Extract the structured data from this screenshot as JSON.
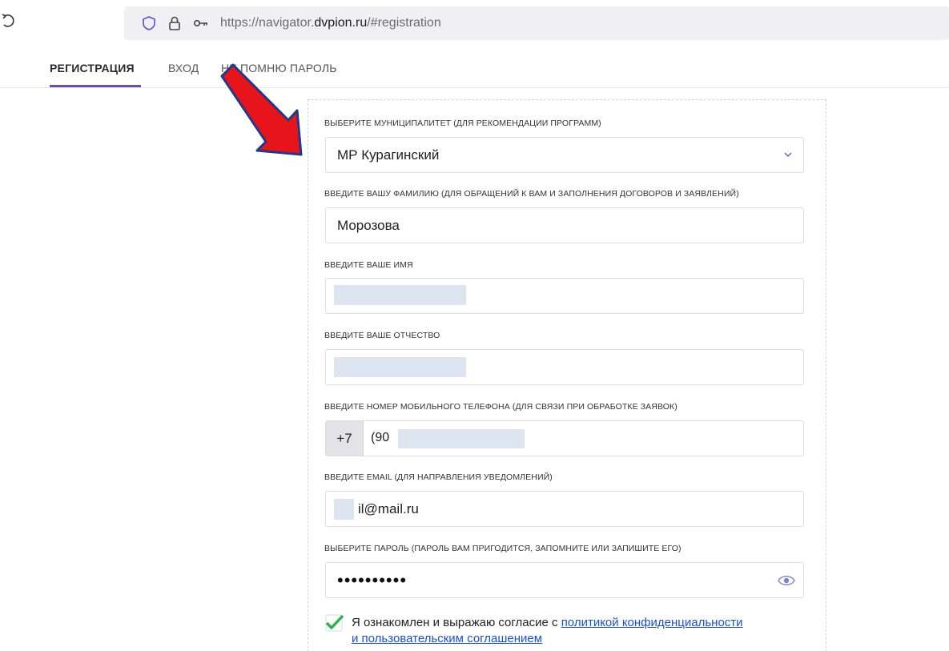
{
  "browser": {
    "url_prefix": "https://navigator.",
    "url_host": "dvpion.ru",
    "url_suffix": "/#registration"
  },
  "tabs": [
    {
      "label": "РЕГИСТРАЦИЯ",
      "active": true
    },
    {
      "label": "ВХОД",
      "active": false
    },
    {
      "label": "НЕ ПОМНЮ ПАРОЛЬ",
      "active": false
    }
  ],
  "form": {
    "municipality": {
      "label": "ВЫБЕРИТЕ МУНИЦИПАЛИТЕТ (ДЛЯ РЕКОМЕНДАЦИИ ПРОГРАММ)",
      "value": "МР Курагинский"
    },
    "surname": {
      "label": "ВВЕДИТЕ ВАШУ ФАМИЛИЮ (ДЛЯ ОБРАЩЕНИЙ К ВАМ И ЗАПОЛНЕНИЯ ДОГОВОРОВ И ЗАЯВЛЕНИЙ)",
      "value": "Морозова"
    },
    "name": {
      "label": "ВВЕДИТЕ ВАШЕ ИМЯ",
      "value": ""
    },
    "patronymic": {
      "label": "ВВЕДИТЕ ВАШЕ ОТЧЕСТВО",
      "value": ""
    },
    "phone": {
      "label": "ВВЕДИТЕ НОМЕР МОБИЛЬНОГО ТЕЛЕФОНА (ДЛЯ СВЯЗИ ПРИ ОБРАБОТКЕ ЗАЯВОК)",
      "prefix": "+7",
      "value": "(90"
    },
    "email": {
      "label": "ВВЕДИТЕ EMAIL (ДЛЯ НАПРАВЛЕНИЯ УВЕДОМЛЕНИЙ)",
      "value": "il@mail.ru"
    },
    "password": {
      "label": "ВЫБЕРИТЕ ПАРОЛЬ (ПАРОЛЬ ВАМ ПРИГОДИТСЯ, ЗАПОМНИТЕ ИЛИ ЗАПИШИТЕ ЕГО)",
      "value": "••••••••••"
    },
    "consent": {
      "checked": true,
      "text": "Я ознакомлен и выражаю согласие с ",
      "link_1": "политикой конфиденциальности",
      "link_2": "и пользовательским соглашением"
    }
  },
  "colors": {
    "accent": "#6a4fa3",
    "link": "#1a4fd8",
    "check": "#2bb24c",
    "arrow_fill": "#e8141c",
    "arrow_stroke": "#1f3a8c",
    "redaction": "#dce4f0"
  },
  "icons": [
    "reload-icon",
    "shield-icon",
    "lock-icon",
    "key-icon",
    "chevron-down-icon",
    "eye-icon",
    "checkmark-icon"
  ]
}
